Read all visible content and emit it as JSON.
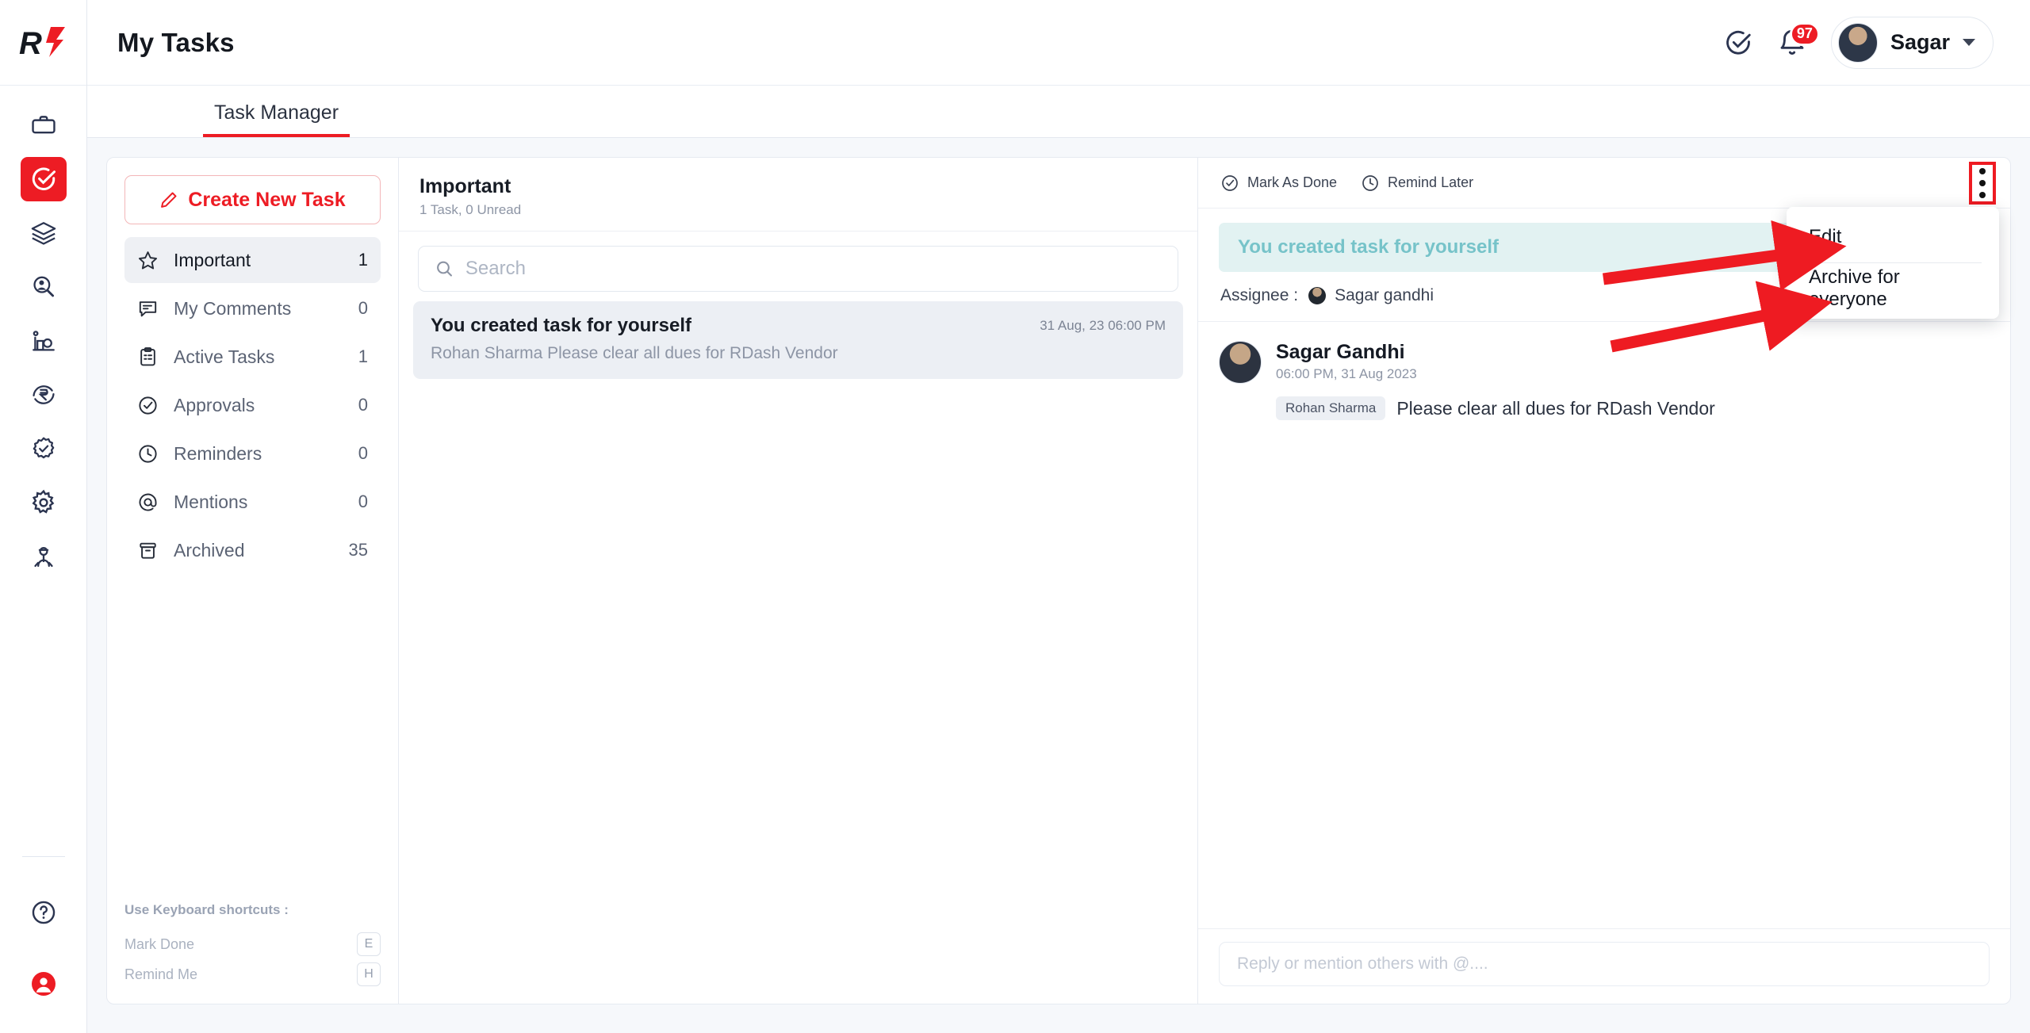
{
  "app": {
    "logo_text": "R",
    "brand_color": "#ed1c24"
  },
  "rail": {
    "items": [
      {
        "name": "briefcase-icon",
        "label": "Projects",
        "active": false
      },
      {
        "name": "task-check-icon",
        "label": "Tasks",
        "active": true
      },
      {
        "name": "layers-icon",
        "label": "Layers",
        "active": false
      },
      {
        "name": "people-search-icon",
        "label": "Directory",
        "active": false
      },
      {
        "name": "analytics-icon",
        "label": "Analytics",
        "active": false
      },
      {
        "name": "rupee-icon",
        "label": "Finance",
        "active": false
      },
      {
        "name": "approval-badge-icon",
        "label": "Approvals",
        "active": false
      },
      {
        "name": "gear-icon",
        "label": "Settings",
        "active": false
      },
      {
        "name": "worker-icon",
        "label": "Workforce",
        "active": false
      }
    ],
    "bottom": [
      {
        "name": "help-icon",
        "label": "Help"
      },
      {
        "name": "support-icon",
        "label": "Support"
      }
    ]
  },
  "header": {
    "title": "My Tasks",
    "check_icon": "check-circle-icon",
    "bell_icon": "bell-icon",
    "notification_count": "97",
    "user_name": "Sagar",
    "caret_icon": "chevron-down-icon"
  },
  "tabs": [
    {
      "label": "Task Manager",
      "active": true
    }
  ],
  "filters": {
    "create_button": "Create New Task",
    "create_icon": "pencil-icon",
    "items": [
      {
        "icon": "star-icon",
        "label": "Important",
        "count": "1",
        "active": true
      },
      {
        "icon": "comment-icon",
        "label": "My Comments",
        "count": "0",
        "active": false
      },
      {
        "icon": "clipboard-icon",
        "label": "Active Tasks",
        "count": "1",
        "active": false
      },
      {
        "icon": "check-badge-icon",
        "label": "Approvals",
        "count": "0",
        "active": false
      },
      {
        "icon": "clock-icon",
        "label": "Reminders",
        "count": "0",
        "active": false
      },
      {
        "icon": "at-icon",
        "label": "Mentions",
        "count": "0",
        "active": false
      },
      {
        "icon": "archive-icon",
        "label": "Archived",
        "count": "35",
        "active": false
      }
    ],
    "shortcuts": {
      "title": "Use Keyboard shortcuts :",
      "rows": [
        {
          "label": "Mark Done",
          "key": "E"
        },
        {
          "label": "Remind Me",
          "key": "H"
        }
      ]
    }
  },
  "list": {
    "title": "Important",
    "subtitle": "1 Task,  0 Unread",
    "search": {
      "icon": "search-icon",
      "value": "",
      "placeholder": "Search"
    },
    "tasks": [
      {
        "title": "You created task for yourself",
        "time": "31 Aug, 23 06:00 PM",
        "preview": "Rohan Sharma Please clear all dues for RDash Vendor",
        "selected": true
      }
    ]
  },
  "detail": {
    "actions": [
      {
        "icon": "check-circle-icon",
        "label": "Mark As Done"
      },
      {
        "icon": "clock-icon",
        "label": "Remind Later"
      }
    ],
    "kebab_icon": "more-vertical-icon",
    "banner": "You created task for yourself",
    "assignee_label": "Assignee :",
    "assignee_name": "Sagar gandhi",
    "message": {
      "author": "Sagar Gandhi",
      "timestamp": "06:00 PM, 31 Aug 2023",
      "mention": "Rohan Sharma",
      "text": "Please clear all dues for RDash Vendor"
    },
    "reply": {
      "value": "",
      "placeholder": "Reply or mention others with @...."
    }
  },
  "menu": {
    "items": [
      {
        "label": "Edit"
      },
      {
        "label": "Archive for everyone"
      }
    ]
  },
  "annotations": {
    "highlight_color": "#ee1b22",
    "arrows": [
      {
        "target": "Edit"
      },
      {
        "target": "Archive for everyone"
      }
    ]
  }
}
